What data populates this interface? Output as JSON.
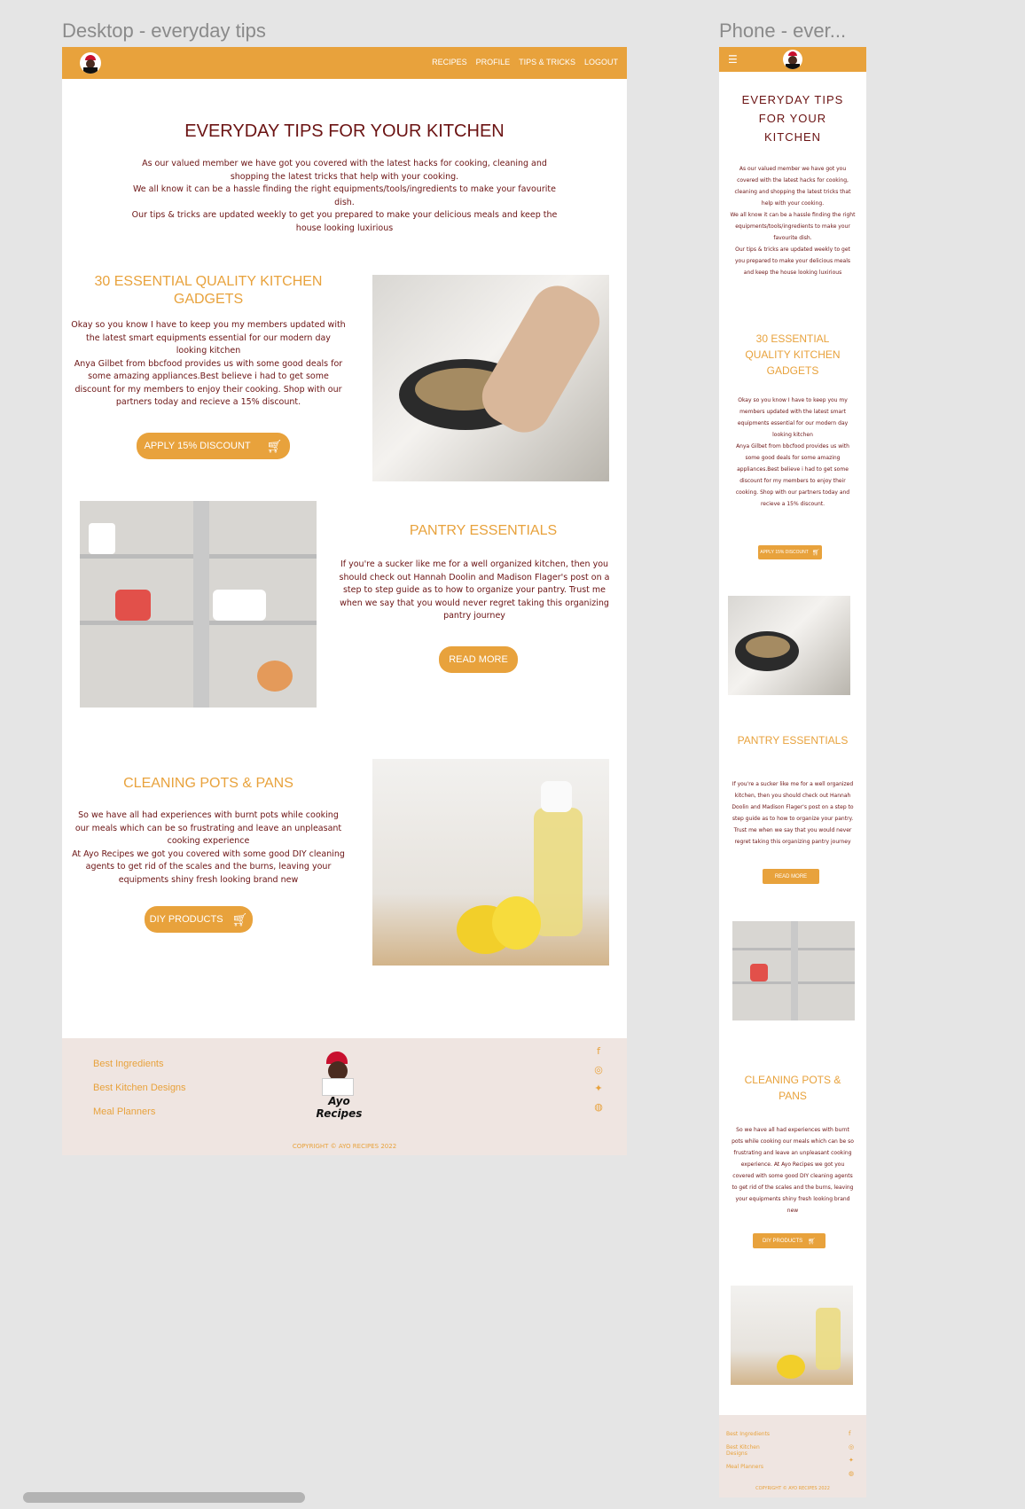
{
  "frames": {
    "desktop_title": "Desktop - everyday tips",
    "phone_title": "Phone - ever..."
  },
  "nav": {
    "items": [
      "RECIPES",
      "PROFILE",
      "TIPS & TRICKS",
      "LOGOUT"
    ],
    "menu_icon": "hamburger-icon",
    "logo_icon": "chef-logo-icon"
  },
  "hero": {
    "title": "EVERYDAY TIPS FOR YOUR KITCHEN",
    "phone_title_lines": [
      "EVERYDAY TIPS",
      "FOR YOUR",
      "KITCHEN"
    ],
    "paragraph": "As our valued member we have got you covered with the latest hacks for cooking, cleaning and shopping the latest tricks that help with your cooking.",
    "paragraph2": "We all know it can be a hassle finding the right equipments/tools/ingredients to make your favourite dish.",
    "paragraph3": "Our tips & tricks are updated weekly to get you prepared to make your delicious meals and keep the house looking luxirious"
  },
  "sections": {
    "gadgets": {
      "title": "30 ESSENTIAL QUALITY KITCHEN GADGETS",
      "p1": "Okay so you know I have to keep you my members updated with the latest smart equipments essential for our modern day looking kitchen",
      "p2": "Anya Gilbet from bbcfood provides us with some good deals for some amazing appliances.Best believe i had to get some discount for my members to enjoy their cooking. Shop with our partners today and recieve a 15% discount.",
      "button": "APPLY 15% DISCOUNT",
      "button_icon": "cart-icon"
    },
    "pantry": {
      "title": "PANTRY ESSENTIALS",
      "p1": "If you're a sucker like me for a well organized kitchen, then you should check out Hannah Doolin and Madison Flager's post on a step to step guide as to how to organize your pantry. Trust me when we say that you would never regret taking this organizing pantry journey",
      "button": "READ MORE"
    },
    "cleaning": {
      "title": "CLEANING POTS & PANS",
      "p1": "So we have all had experiences with burnt pots while cooking our meals which can be so frustrating and leave an unpleasant cooking experience",
      "p2": "At Ayo Recipes we got you covered with some good DIY cleaning agents to get rid of the scales and the burns, leaving your equipments shiny fresh looking brand new",
      "button": "DIY PRODUCTS",
      "button_icon": "cart-icon"
    }
  },
  "footer": {
    "links": [
      "Best Ingredients",
      "Best Kitchen Designs",
      "Meal Planners"
    ],
    "logo_text": "Ayo Recipes",
    "copyright": "COPYRIGHT © AYO RECIPES 2022",
    "social": [
      "f",
      "◎",
      "✦",
      "◍"
    ],
    "social_names": [
      "facebook-icon",
      "instagram-icon",
      "twitter-icon",
      "github-icon"
    ]
  },
  "colors": {
    "accent": "#e8a23c",
    "text": "#6b1313",
    "footer_bg": "#efe5e1"
  }
}
